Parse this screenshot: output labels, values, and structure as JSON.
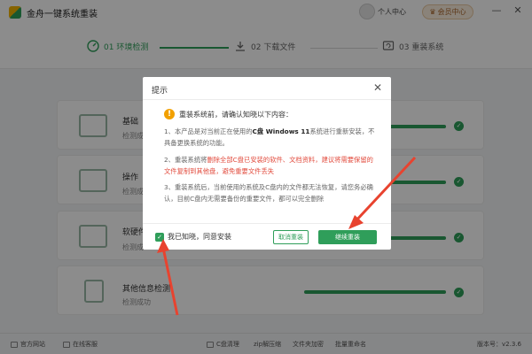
{
  "app": {
    "title": "金舟一键系统重装",
    "user_center": "个人中心",
    "vip_label": "会员中心"
  },
  "steps": [
    {
      "label": "01 环境检测",
      "active": true
    },
    {
      "label": "02 下载文件",
      "active": false
    },
    {
      "label": "03 重装系统",
      "active": false
    }
  ],
  "cards": [
    {
      "name": "基础",
      "status": "检测成"
    },
    {
      "name": "操作",
      "status": "检测成"
    },
    {
      "name": "软硬件",
      "status": "检测成"
    },
    {
      "name": "其他信息检测",
      "status": "检测成功"
    }
  ],
  "footer": {
    "official_site": "官方网站",
    "online_service": "在线客服",
    "c_clean": "C盘清理",
    "zip_compress": "zip解压缩",
    "file_encrypt": "文件夹加密",
    "batch_rename": "批量重命名",
    "version": "版本号：v2.3.6"
  },
  "dialog": {
    "title": "提示",
    "heading": "重装系统前，请确认知晓以下内容：",
    "item1_a": "1、本产品是对当前正在使用的",
    "item1_b": "C盘 Windows 11",
    "item1_c": "系统进行重新安装，不具备更换系统的功能。",
    "item2_a": "2、重装系统将",
    "item2_b": "删除全部C盘已安装的软件、文档资料，建议将需要保留的文件复制到其他盘，避免重要文件丢失",
    "item3": "3、重装系统后，当前使用的系统及C盘内的文件都无法恢复，请您务必确认，目前C盘内无需要备份的重要文件，都可以完全删除",
    "agree_label": "我已知晓，同意安装",
    "cancel_label": "取消重装",
    "continue_label": "继续重装"
  },
  "colors": {
    "accent": "#2f9e5a",
    "warning": "#f2a000",
    "danger": "#e24b3d",
    "arrow": "#e8432f"
  }
}
